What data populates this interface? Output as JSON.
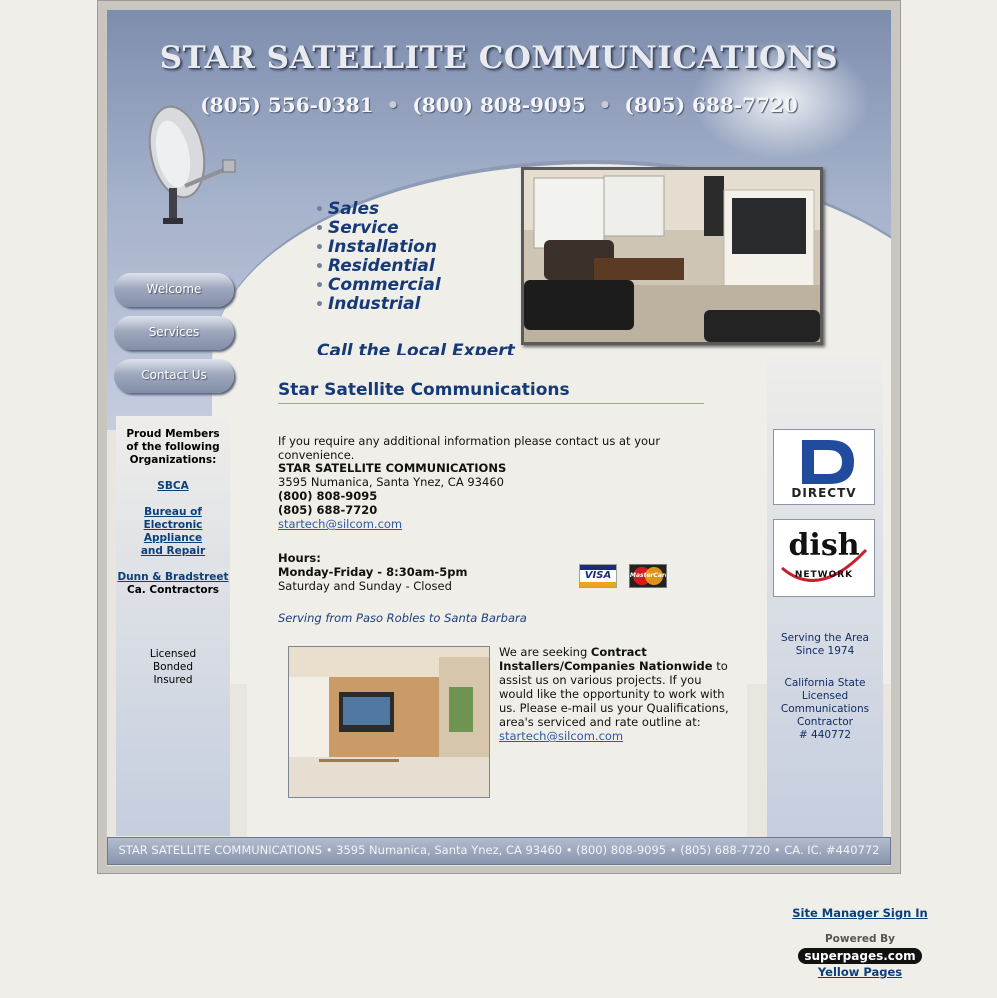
{
  "header": {
    "title": "STAR SATELLITE COMMUNICATIONS",
    "phones": [
      "(805) 556-0381",
      "(800) 808-9095",
      "(805) 688-7720"
    ],
    "phone_separator": "•"
  },
  "services": {
    "bullet": "•",
    "items": [
      "Sales",
      "Service",
      "Installation",
      "Residential",
      "Commercial",
      "Industrial"
    ],
    "tagline": "Call the Local Expert"
  },
  "nav": {
    "items": [
      {
        "label": "Welcome"
      },
      {
        "label": "Services"
      },
      {
        "label": "Contact Us"
      }
    ]
  },
  "left_sidebar": {
    "members_heading": [
      "Proud Members",
      "of the following",
      "Organizations:"
    ],
    "links": {
      "sbca": "SBCA",
      "bureau": [
        "Bureau of",
        "Electronic",
        "Appliance",
        "and Repair"
      ],
      "dunn": "Dunn & Bradstreet"
    },
    "dunn_sub": "Ca. Contractors",
    "credentials": [
      "Licensed",
      "Bonded",
      "Insured"
    ]
  },
  "right_sidebar": {
    "directv_label": "DIRECTV",
    "dish_label": "dish",
    "dish_sub": "NETWORK",
    "serving": [
      "Serving the Area",
      "Since 1974"
    ],
    "license": [
      "California State",
      "Licensed",
      "Communications",
      "Contractor",
      "# 440772"
    ]
  },
  "content": {
    "heading": "Star Satellite Communications",
    "intro": "If you require any additional information please contact us at your convenience.",
    "company": "STAR SATELLITE COMMUNICATIONS",
    "address": "3595 Numanica, Santa Ynez, CA 93460",
    "phone1": "(800) 808-9095",
    "phone2": "(805) 688-7720",
    "email": "startech@silcom.com",
    "hours_label": "Hours:",
    "hours_weekday": "Monday-Friday  - 8:30am-5pm",
    "hours_weekend": "Saturday and Sunday - Closed",
    "visa": "VISA",
    "mastercard": "MasterCard",
    "serving": "Serving from Paso Robles to Santa Barbara",
    "seeking_pre": "We are seeking ",
    "seeking_bold": "Contract Installers/Companies Nationwide",
    "seeking_post": " to assist us on various projects. If you would like the opportunity to work with us. Please e-mail us your Qualifications, area's serviced and rate outline at:",
    "seeking_email": "startech@silcom.com"
  },
  "footer": {
    "text": "STAR SATELLITE COMMUNICATIONS • 3595 Numanica, Santa Ynez, CA 93460 • (800) 808-9095 • (805) 688-7720 • CA. IC. #440772"
  },
  "page_footer": {
    "site_manager": "Site Manager Sign In",
    "powered_by": "Powered By",
    "superpages": "superpages.com",
    "yellow_pages": "Yellow Pages"
  }
}
